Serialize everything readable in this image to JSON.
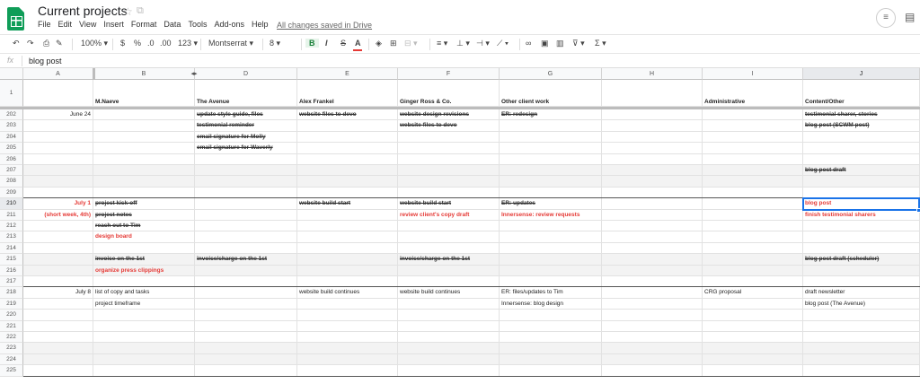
{
  "app": {
    "title": "Current projects",
    "saved_status": "All changes saved in Drive",
    "menus": [
      "File",
      "Edit",
      "View",
      "Insert",
      "Format",
      "Data",
      "Tools",
      "Add-ons",
      "Help"
    ]
  },
  "toolbar": {
    "zoom": "100%",
    "currency": "$",
    "percent": "%",
    "dec_less": ".0",
    "dec_more": ".00",
    "more_formats": "123",
    "font": "Montserrat",
    "font_size": "8",
    "bold": "B",
    "italic": "I",
    "strike": "S",
    "text_color": "A",
    "sum": "Σ"
  },
  "formula_bar": {
    "label": "fx",
    "value": "blog post"
  },
  "columns": [
    "A",
    "B",
    "D",
    "E",
    "F",
    "G",
    "H",
    "I",
    "J"
  ],
  "grid": {
    "selected_column": "J",
    "selected_row": "210",
    "header_row": {
      "num": "1",
      "cells": [
        "",
        "M.Naeve",
        "The Avenue",
        "Alex Frankel",
        "Ginger Ross & Co.",
        "Other client work",
        "",
        "Administrative",
        "Content/Other"
      ]
    },
    "rows": [
      {
        "num": "202",
        "cells": [
          "June 24",
          "",
          "update style guide, files",
          "website files to devo",
          "website design revisions",
          "ER: redesign",
          "",
          "",
          "testimonial sharer, stories"
        ]
      },
      {
        "num": "203",
        "cells": [
          "",
          "",
          "testimonial reminder",
          "",
          "website files to devo",
          "",
          "",
          "",
          "blog post (SCWM post)"
        ]
      },
      {
        "num": "204",
        "cells": [
          "",
          "",
          "email signature for Molly",
          "",
          "",
          "",
          "",
          "",
          ""
        ]
      },
      {
        "num": "205",
        "cells": [
          "",
          "",
          "email signature for Waverly",
          "",
          "",
          "",
          "",
          "",
          ""
        ]
      },
      {
        "num": "206",
        "cells": [
          "",
          "",
          "",
          "",
          "",
          "",
          "",
          "",
          ""
        ]
      },
      {
        "num": "207",
        "cells": [
          "",
          "",
          "",
          "",
          "",
          "",
          "",
          "",
          "blog post draft"
        ]
      },
      {
        "num": "208",
        "cells": [
          "",
          "",
          "",
          "",
          "",
          "",
          "",
          "",
          ""
        ]
      },
      {
        "num": "209",
        "cells": [
          "",
          "",
          "",
          "",
          "",
          "",
          "",
          "",
          ""
        ]
      },
      {
        "num": "210",
        "cells": [
          "July 1",
          "project kick-off",
          "",
          "website build start",
          "website build start",
          "ER: updates",
          "",
          "",
          "blog post"
        ]
      },
      {
        "num": "211",
        "cells": [
          "(short week, 4th)",
          "project notes",
          "",
          "",
          "review client's copy draft",
          "Innersense: review requests",
          "",
          "",
          "finish testimonial sharers"
        ]
      },
      {
        "num": "212",
        "cells": [
          "",
          "reach out to Tim",
          "",
          "",
          "",
          "",
          "",
          "",
          ""
        ]
      },
      {
        "num": "213",
        "cells": [
          "",
          "design board",
          "",
          "",
          "",
          "",
          "",
          "",
          ""
        ]
      },
      {
        "num": "214",
        "cells": [
          "",
          "",
          "",
          "",
          "",
          "",
          "",
          "",
          ""
        ]
      },
      {
        "num": "215",
        "cells": [
          "",
          "invoice on the 1st",
          "invoice/charge on the 1st",
          "",
          "invoice/charge on the 1st",
          "",
          "",
          "",
          "blog post draft (scheduler)"
        ]
      },
      {
        "num": "216",
        "cells": [
          "",
          "organize press clippings",
          "",
          "",
          "",
          "",
          "",
          "",
          ""
        ]
      },
      {
        "num": "217",
        "cells": [
          "",
          "",
          "",
          "",
          "",
          "",
          "",
          "",
          ""
        ]
      },
      {
        "num": "218",
        "cells": [
          "July 8",
          "list of copy and tasks",
          "",
          "website build continues",
          "website build continues",
          "ER: files/updates to Tim",
          "",
          "CRG proposal",
          "draft newsletter"
        ]
      },
      {
        "num": "219",
        "cells": [
          "",
          "project timeframe",
          "",
          "",
          "",
          "Innersense: blog design",
          "",
          "",
          "blog post (The Avenue)"
        ]
      },
      {
        "num": "220",
        "cells": [
          "",
          "",
          "",
          "",
          "",
          "",
          "",
          "",
          ""
        ]
      },
      {
        "num": "221",
        "cells": [
          "",
          "",
          "",
          "",
          "",
          "",
          "",
          "",
          ""
        ]
      },
      {
        "num": "222",
        "cells": [
          "",
          "",
          "",
          "",
          "",
          "",
          "",
          "",
          ""
        ]
      },
      {
        "num": "223",
        "cells": [
          "",
          "",
          "",
          "",
          "",
          "",
          "",
          "",
          ""
        ]
      },
      {
        "num": "224",
        "cells": [
          "",
          "",
          "",
          "",
          "",
          "",
          "",
          "",
          ""
        ]
      },
      {
        "num": "225",
        "cells": [
          "",
          "",
          "",
          "",
          "",
          "",
          "",
          "",
          ""
        ]
      }
    ]
  },
  "colors": {
    "accent_green": "#0f9d58",
    "red_text": "#e53935",
    "selection": "#1a73e8"
  }
}
